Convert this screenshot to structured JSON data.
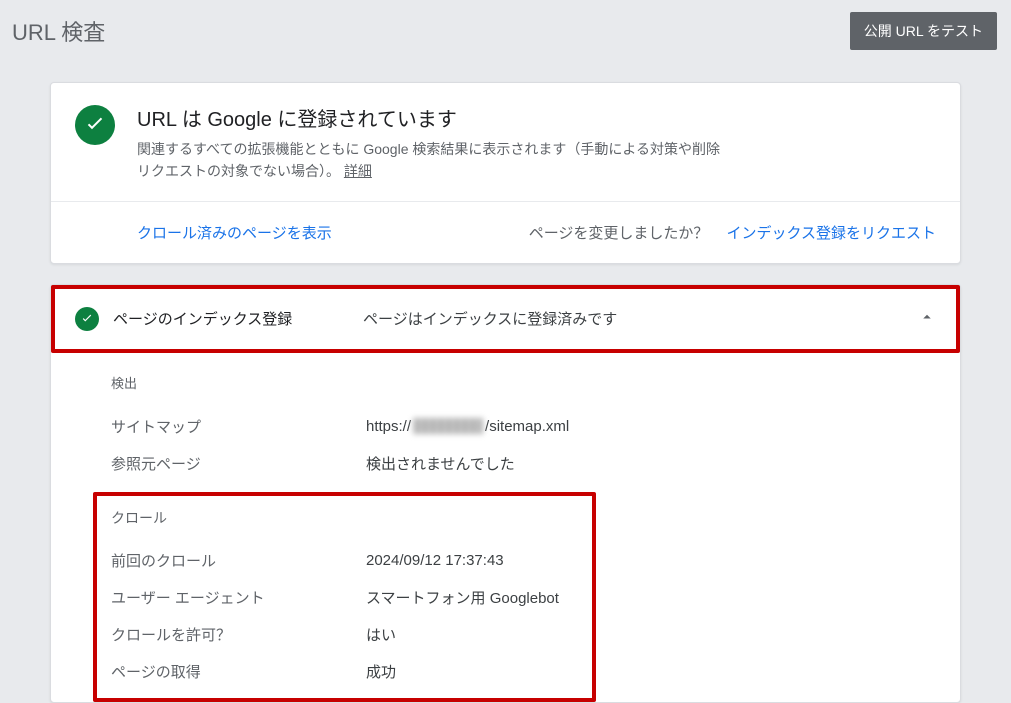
{
  "header": {
    "title": "URL 検査",
    "test_button": "公開 URL をテスト"
  },
  "status": {
    "title": "URL は Google に登録されています",
    "description_prefix": "関連するすべての拡張機能とともに Google 検索結果に表示されます（手動による対策や削除リクエストの対象でない場合）。",
    "details_link": "詳細"
  },
  "footer": {
    "view_crawled": "クロール済みのページを表示",
    "changed_question": "ページを変更しましたか？",
    "request_indexing": "インデックス登録をリクエスト"
  },
  "indexing": {
    "section_title": "ページのインデックス登録",
    "section_status": "ページはインデックスに登録済みです"
  },
  "discovery": {
    "heading": "検出",
    "sitemap_label": "サイトマップ",
    "sitemap_value_prefix": "https://",
    "sitemap_value_suffix": "/sitemap.xml",
    "referrer_label": "参照元ページ",
    "referrer_value": "検出されませんでした"
  },
  "crawl": {
    "heading": "クロール",
    "last_crawl_label": "前回のクロール",
    "last_crawl_value": "2024/09/12 17:37:43",
    "user_agent_label": "ユーザー エージェント",
    "user_agent_value": "スマートフォン用 Googlebot",
    "crawl_allowed_label": "クロールを許可？",
    "crawl_allowed_value": "はい",
    "page_fetch_label": "ページの取得",
    "page_fetch_value": "成功"
  }
}
